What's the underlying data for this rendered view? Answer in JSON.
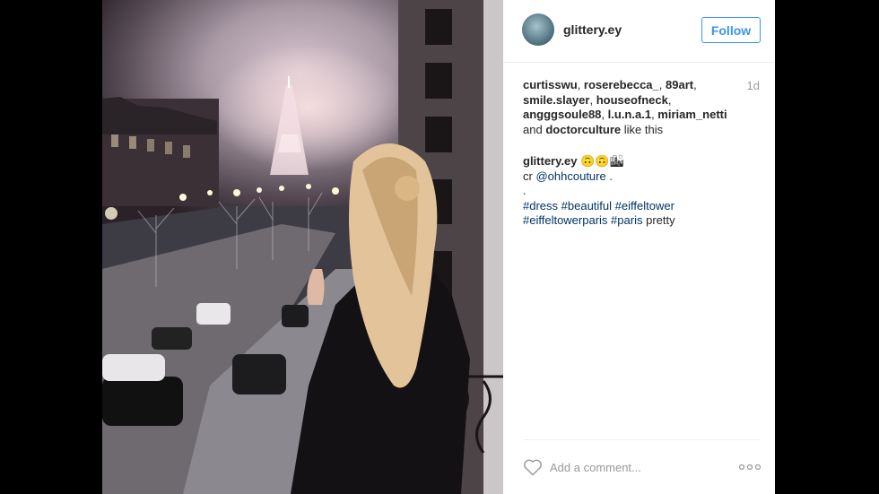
{
  "post": {
    "username": "glittery.ey",
    "follow_label": "Follow",
    "timestamp": "1d",
    "likes": {
      "users": [
        "curtisswu",
        "roserebecca_",
        "89art",
        "smile.slayer",
        "houseofneck",
        "angggsoule88",
        "l.u.n.a.1",
        "miriam_netti"
      ],
      "and_text": "and",
      "last_user": "doctorculture",
      "suffix": "like this"
    },
    "caption": {
      "author": "glittery.ey",
      "emoji": "🙃🙃🏙",
      "credit_prefix": "cr",
      "credit_mention": "@ohhcouture",
      "credit_suffix": ".",
      "dot": ".",
      "tags": [
        "#dress",
        "#beautiful",
        "#eiffeltower",
        "#eiffeltowerparis",
        "#paris"
      ],
      "trailing": "pretty"
    },
    "comment_placeholder": "Add a comment...",
    "icons": {
      "like": "heart-icon",
      "options": "more-options-icon"
    }
  },
  "colors": {
    "link_blue": "#003569",
    "follow_blue": "#3897f0",
    "text": "#262626",
    "muted": "#999999"
  }
}
